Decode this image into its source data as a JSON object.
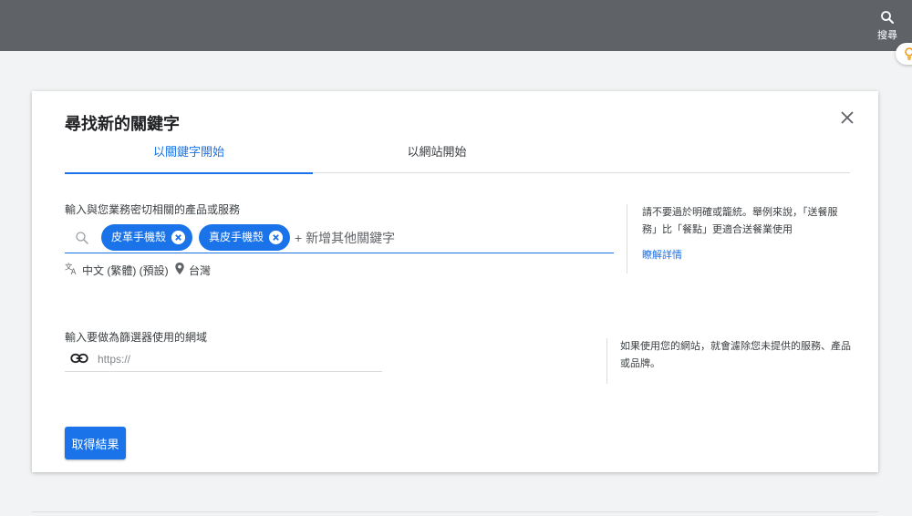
{
  "topbar": {
    "search_label": "搜尋"
  },
  "dialog": {
    "title": "尋找新的關鍵字",
    "tabs": [
      {
        "label": "以關鍵字開始",
        "active": true
      },
      {
        "label": "以網站開始",
        "active": false
      }
    ],
    "keywords_section": {
      "label": "輸入與您業務密切相關的產品或服務",
      "chips": [
        "皮革手機殼",
        "真皮手機殼"
      ],
      "placeholder": "+ 新增其他關鍵字",
      "language": "中文 (繁體) (預設)",
      "location": "台灣",
      "help_text": "請不要過於明確或籠統。舉例來說，「送餐服務」比「餐點」更適合送餐業使用",
      "help_link": "瞭解詳情"
    },
    "domain_section": {
      "label": "輸入要做為篩選器使用的網域",
      "placeholder": "https://",
      "help_text": "如果使用您的網站，就會濾除您未提供的服務、產品或品牌。"
    },
    "submit_label": "取得結果"
  },
  "colors": {
    "accent": "#1a73e8",
    "topbar": "#5f6368",
    "background": "#f1f3f4"
  }
}
